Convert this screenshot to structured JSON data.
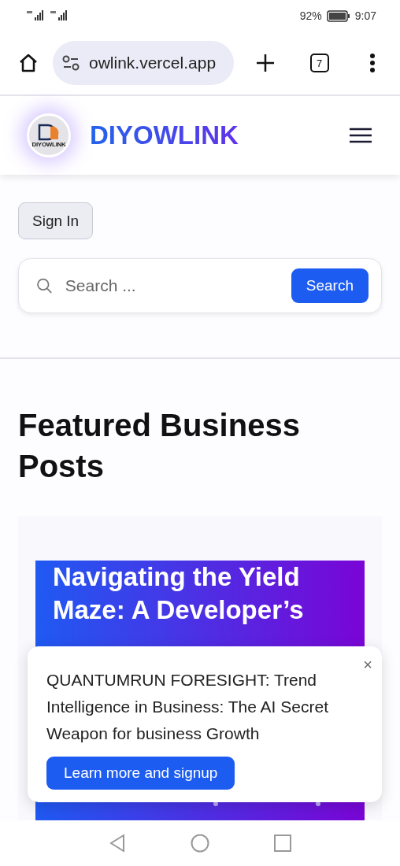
{
  "status_bar": {
    "battery": "92%",
    "time": "9:07"
  },
  "browser": {
    "url": "owlink.vercel.app",
    "tab_count": "7"
  },
  "header": {
    "logo_text": "DIYOWLINK",
    "brand": "DIYOWLINK"
  },
  "sign_in": "Sign In",
  "search": {
    "placeholder": "Search ...",
    "button": "Search"
  },
  "section_title": "Featured Business Posts",
  "post": {
    "title": "Navigating the Yield Maze: A Developer’s"
  },
  "popup": {
    "text": "QUANTUMRUN FORESIGHT: Trend Intelligence in Business: The AI Secret Weapon for business Growth",
    "button": "Learn more and signup",
    "close": "×"
  }
}
